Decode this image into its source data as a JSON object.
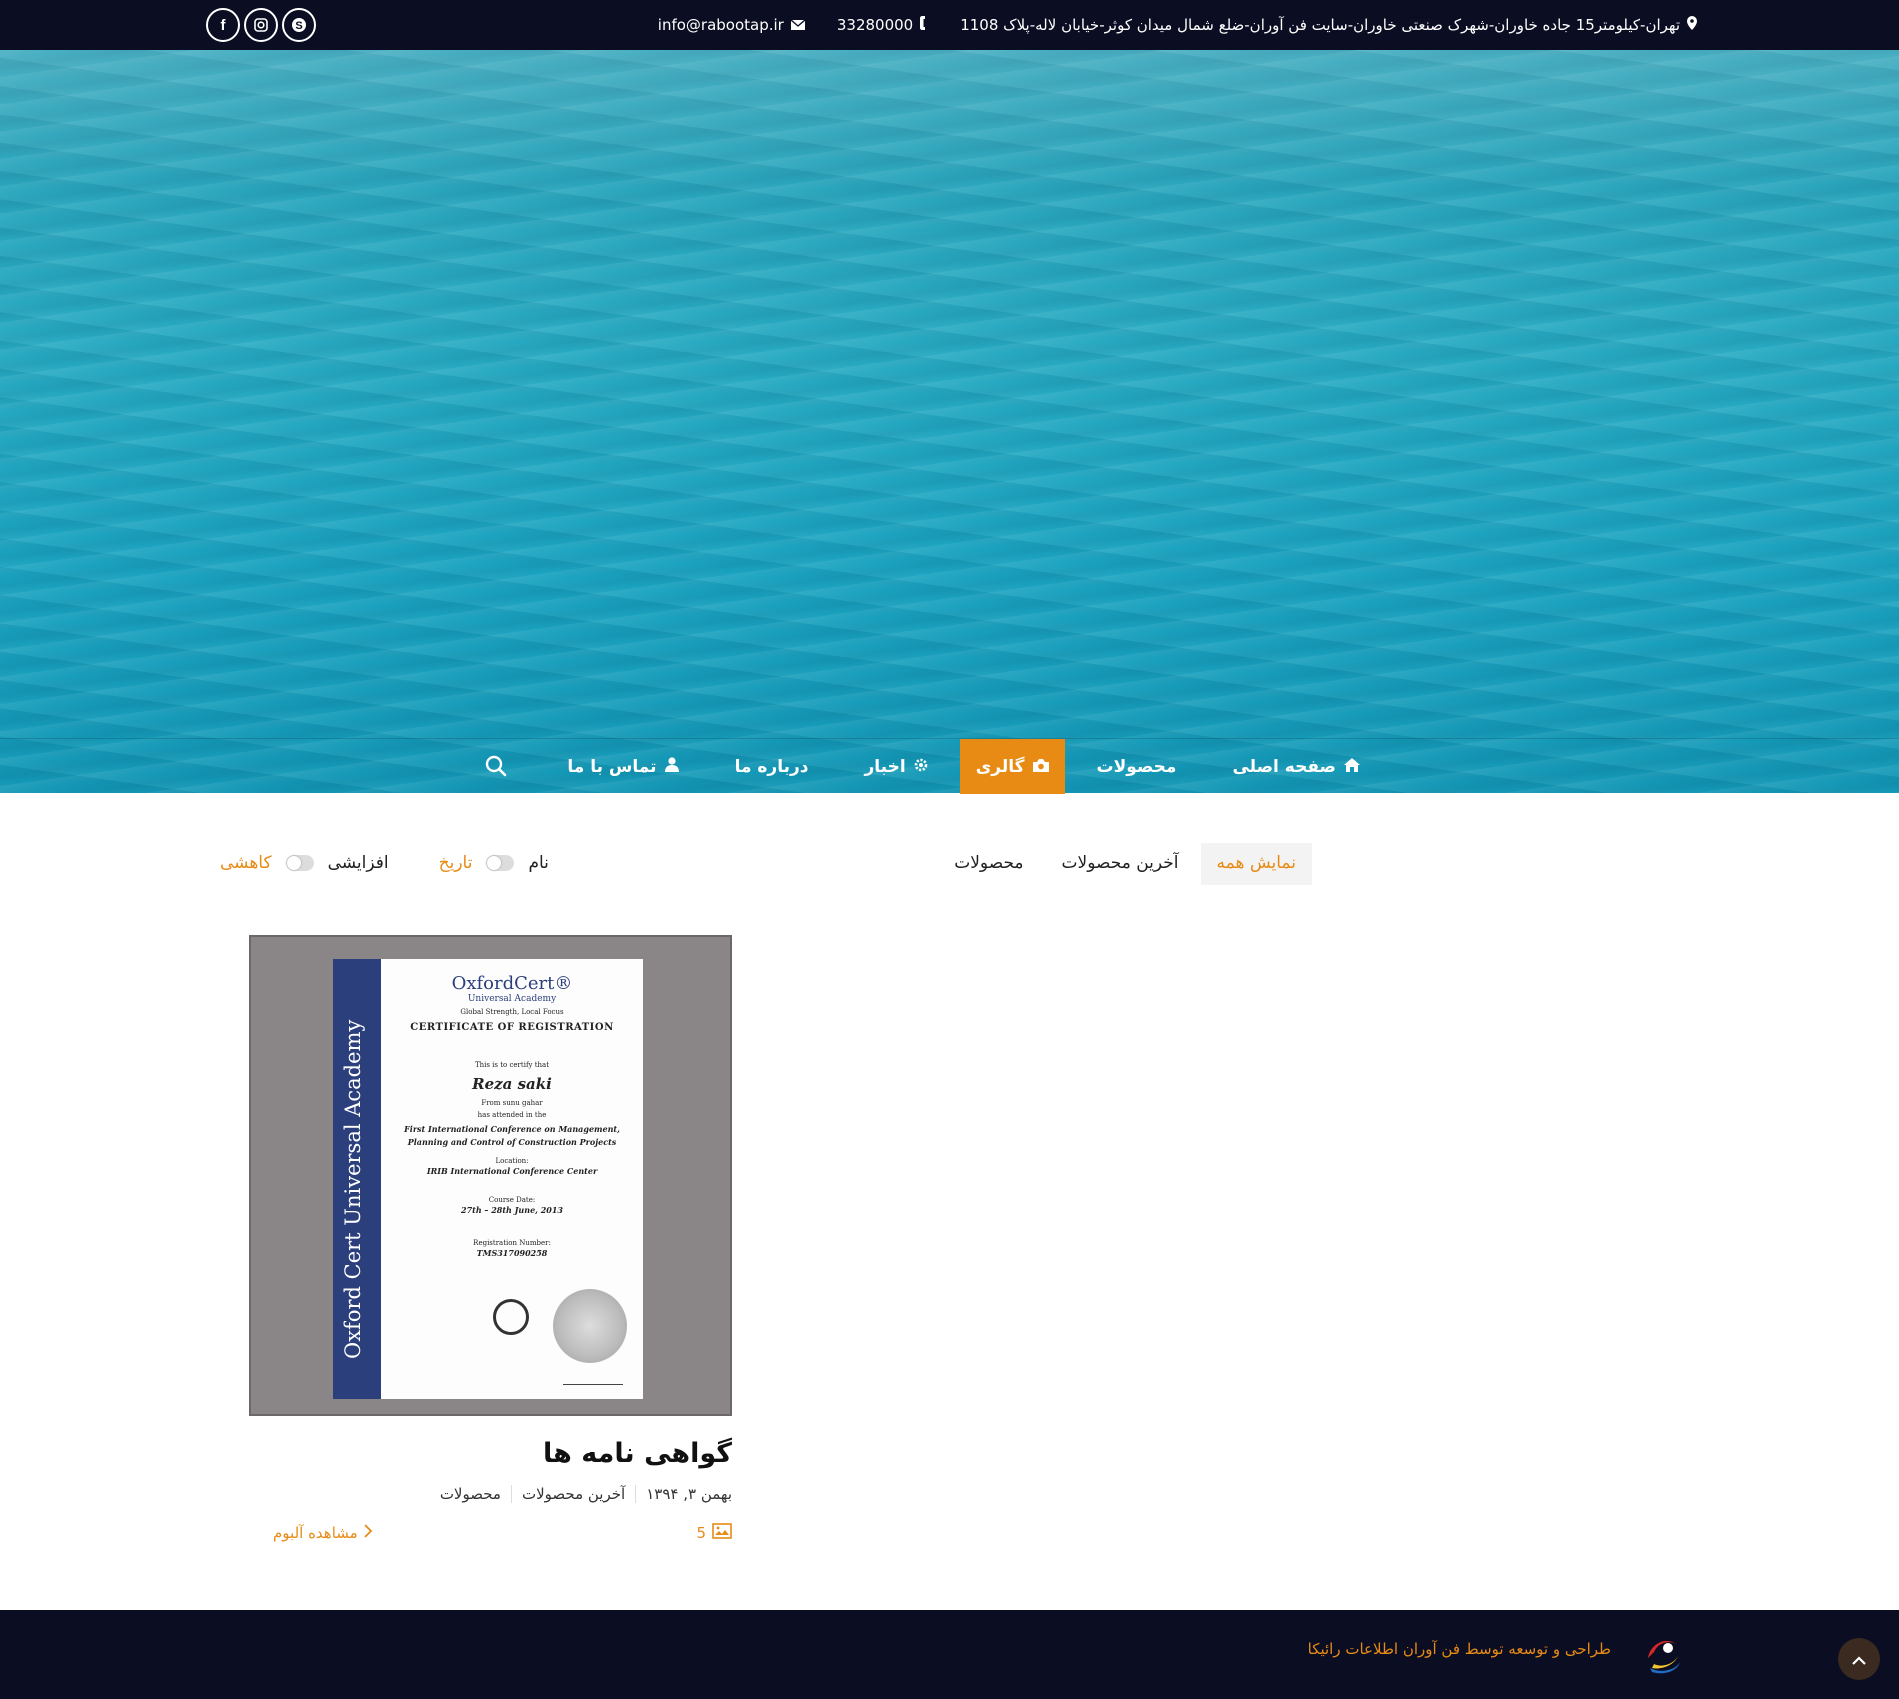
{
  "topbar": {
    "address": "تهران-کیلومتر15 جاده خاوران-شهرک صنعتی خاوران-سایت فن آوران-ضلع شمال میدان کوثر-خیابان لاله-پلاک 1108",
    "phone": "33280000",
    "email": "info@rabootap.ir",
    "social": [
      "facebook-icon",
      "instagram-icon",
      "skype-icon"
    ]
  },
  "nav": {
    "items": [
      {
        "label": "صفحه اصلی",
        "icon": "home-icon"
      },
      {
        "label": "محصولات",
        "icon": ""
      },
      {
        "label": "گالری",
        "icon": "camera-icon",
        "active": true
      },
      {
        "label": "اخبار",
        "icon": "gear-icon"
      },
      {
        "label": "درباره ما",
        "icon": ""
      },
      {
        "label": "تماس با ما",
        "icon": "user-icon"
      }
    ]
  },
  "filters": {
    "tabs": [
      {
        "label": "نمایش همه",
        "active": true
      },
      {
        "label": "آخرین محصولات"
      },
      {
        "label": "محصولات"
      }
    ]
  },
  "sort": {
    "name": "نام",
    "date": "تاریخ",
    "asc": "افزایشی",
    "desc": "کاهشی"
  },
  "album": {
    "title": "گواهی نامه ها",
    "date": "بهمن ۳, ۱۳۹۴",
    "categories": [
      "آخرین محصولات",
      "محصولات"
    ],
    "count": "5",
    "view_label": "مشاهده آلبوم",
    "certificate": {
      "brand": "OxfordCert®",
      "academy": "Universal Academy",
      "slogan": "Global Strength, Local Focus",
      "heading": "CERTIFICATE OF REGISTRATION",
      "certify": "This is to certify that",
      "name": "Reza saki",
      "from": "From sunu gahar",
      "attended": "has attended in the",
      "conference": "First International Conference on Management, Planning and Control of Construction Projects",
      "location_label": "Location:",
      "location": "IRIB International Conference Center",
      "date_label": "Course Date:",
      "date": "27th – 28th June, 2013",
      "reg_label": "Registration Number:",
      "reg": "TMS317090258",
      "band_text": "Oxford Cert Universal Academy"
    }
  },
  "footer": {
    "credit": "طراحی و توسعه توسط فن آوران اطلاعات رائیکا"
  },
  "colors": {
    "accent": "#e88b14",
    "dark": "#0b0d22",
    "water": "#27aac2"
  }
}
